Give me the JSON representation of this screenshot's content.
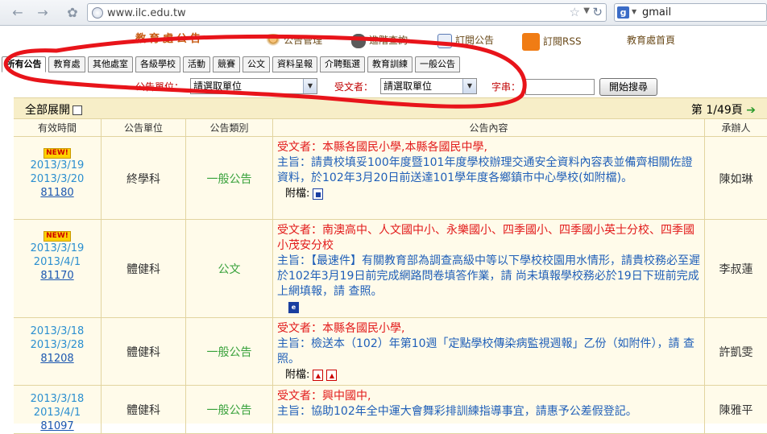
{
  "browser": {
    "url": "www.ilc.edu.tw",
    "search_engine_badge": "g",
    "search_text": "gmail"
  },
  "site": {
    "title": "教育處公告",
    "nav": [
      {
        "label": "公告管理",
        "icon": "person-icon"
      },
      {
        "label": "進階查詢",
        "icon": "binoculars-icon"
      },
      {
        "label": "訂閱公告",
        "icon": "checklist-icon"
      },
      {
        "label": "訂閱RSS",
        "icon": "rss-icon"
      },
      {
        "label": "教育處首頁",
        "icon": ""
      }
    ]
  },
  "tabs": [
    "所有公告",
    "教育處",
    "其他處室",
    "各級學校",
    "活動",
    "競賽",
    "公文",
    "資料呈報",
    "介聘甄選",
    "教育訓練",
    "一般公告"
  ],
  "filter": {
    "unit_label": "公告單位：",
    "unit_value": "請選取單位",
    "receiver_label": "受文者：",
    "receiver_value": "請選取單位",
    "keyword_label": "字串：",
    "keyword_value": "",
    "search_button": "開始搜尋"
  },
  "grid": {
    "expand_all": "全部展開",
    "pager": "第 1/49頁",
    "columns": [
      "有效時間",
      "公告單位",
      "公告類別",
      "公告內容",
      "承辦人"
    ],
    "rows": [
      {
        "new": "NEW!",
        "start": "2013/3/19",
        "end": "2013/3/20",
        "id": "81180",
        "unit": "終學科",
        "category": "一般公告",
        "receiver": "受文者：本縣各國民小學,本縣各國民中學,",
        "subject": "主旨：請貴校填妥100年度暨101年度學校辦理交通安全資料內容表並備齊相關佐證資料，於102年3月20日前送達101學年度各鄉鎮市中心學校(如附檔)。",
        "attach_label": "附檔:",
        "files": [
          "odt"
        ],
        "person": "陳如琳"
      },
      {
        "new": "NEW!",
        "start": "2013/3/19",
        "end": "2013/4/1",
        "id": "81170",
        "unit": "體健科",
        "category": "公文",
        "receiver": "受文者：南澳高中、人文國中小、永樂國小、四季國小、四季國小英士分校、四季國小茂安分校",
        "subject": "主旨：【最速件】有關教育部為調查高級中等以下學校校園用水情形，請貴校務必至遲於102年3月19日前完成網路問卷填答作業，請 尚未填報學校務必於19日下班前完成上網填報，請 查照。",
        "attach_label": "",
        "files": [
          "doc"
        ],
        "person": "李叔蓮"
      },
      {
        "new": "",
        "start": "2013/3/18",
        "end": "2013/3/28",
        "id": "81208",
        "unit": "體健科",
        "category": "一般公告",
        "receiver": "受文者：本縣各國民小學,",
        "subject": "主旨：檢送本（102）年第10週「定點學校傳染病監視週報」乙份（如附件），請 查照。",
        "attach_label": "附檔:",
        "files": [
          "pdf",
          "pdf"
        ],
        "person": "許凱雯"
      },
      {
        "new": "",
        "start": "2013/3/18",
        "end": "2013/4/1",
        "id": "81097",
        "unit": "體健科",
        "category": "一般公告",
        "receiver": "受文者：興中國中,",
        "subject": "主旨：協助102年全中運大會舞彩排訓練指導事宜，請惠予公差假登記。",
        "attach_label": "",
        "files": [],
        "person": "陳雅平"
      }
    ]
  },
  "colors": {
    "annotation": "#e8141a",
    "grid_bg": "#fffbea",
    "header_bg": "#f7eec8",
    "receiver_text": "#e21a1a",
    "subject_text": "#1f5fb8",
    "category_text": "#37a13a"
  }
}
